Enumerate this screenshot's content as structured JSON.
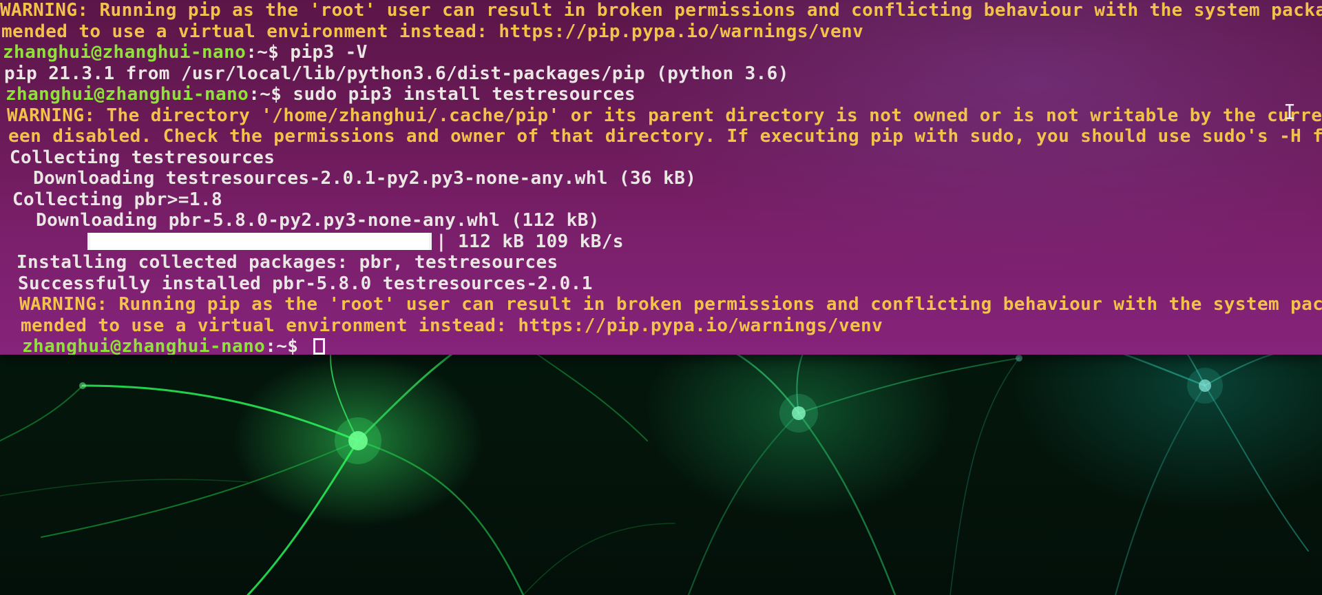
{
  "terminal": {
    "lines": [
      {
        "type": "warn",
        "text": "WARNING: Running pip as the 'root' user can result in broken permissions and conflicting behaviour with the system package ma"
      },
      {
        "type": "warn",
        "text": "mended to use a virtual environment instead: https://pip.pypa.io/warnings/venv"
      },
      {
        "type": "prompt",
        "user": "zhanghui@zhanghui-nano",
        "path": ":~$ ",
        "command": "pip3 -V"
      },
      {
        "type": "output",
        "text": "pip 21.3.1 from /usr/local/lib/python3.6/dist-packages/pip (python 3.6)"
      },
      {
        "type": "prompt",
        "user": "zhanghui@zhanghui-nano",
        "path": ":~$ ",
        "command": "sudo pip3 install testresources"
      },
      {
        "type": "warn",
        "text": "WARNING: The directory '/home/zhanghui/.cache/pip' or its parent directory is not owned or is not writable by the current user"
      },
      {
        "type": "warn",
        "text": "een disabled. Check the permissions and owner of that directory. If executing pip with sudo, you should use sudo's -H flag."
      },
      {
        "type": "output",
        "text": "Collecting testresources"
      },
      {
        "type": "output",
        "text": "  Downloading testresources-2.0.1-py2.py3-none-any.whl (36 kB)"
      },
      {
        "type": "output",
        "text": "Collecting pbr>=1.8"
      },
      {
        "type": "output",
        "text": "  Downloading pbr-5.8.0-py2.py3-none-any.whl (112 kB)"
      },
      {
        "type": "progress",
        "text": "| 112 kB 109 kB/s",
        "fraction": 1.0
      },
      {
        "type": "output",
        "text": "Installing collected packages: pbr, testresources"
      },
      {
        "type": "output",
        "text": "Successfully installed pbr-5.8.0 testresources-2.0.1"
      },
      {
        "type": "warn",
        "text": "WARNING: Running pip as the 'root' user can result in broken permissions and conflicting behaviour with the system package manag"
      },
      {
        "type": "warn",
        "text": "mended to use a virtual environment instead: https://pip.pypa.io/warnings/venv"
      },
      {
        "type": "prompt_active",
        "user": "zhanghui@zhanghui-nano",
        "path": ":~$ ",
        "command": ""
      }
    ]
  },
  "colors": {
    "terminal_bg": "#6a1a57",
    "warning_text": "#f2c24a",
    "prompt_user": "#8fe23a",
    "normal_text": "#e9e6e4",
    "wallpaper_glow": "#3cff6e"
  },
  "icons": {
    "mouse_cursor": "text-ibeam-icon",
    "terminal_cursor": "block-cursor-icon"
  }
}
